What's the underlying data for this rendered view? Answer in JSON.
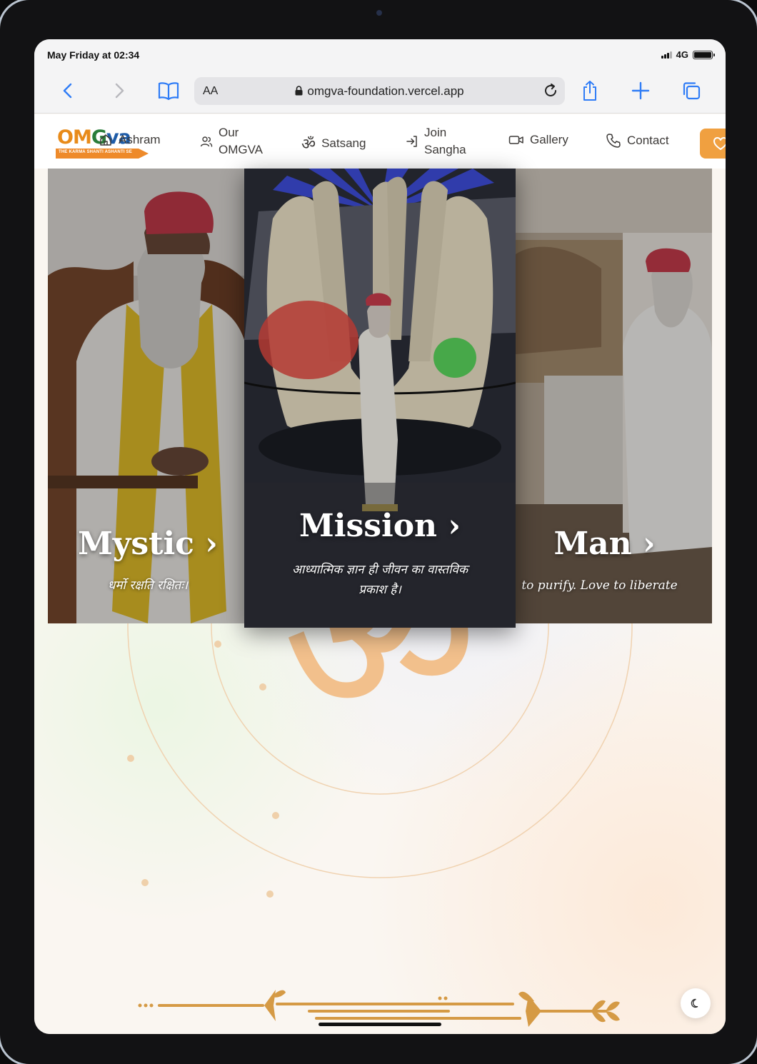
{
  "status": {
    "time": "May Friday at 02:34",
    "network": "4G"
  },
  "browser": {
    "text_size_label": "AA",
    "url": "omgva-foundation.vercel.app",
    "icons": [
      "back-icon",
      "forward-icon",
      "bookmarks-icon",
      "reload-icon",
      "share-icon",
      "new-tab-icon",
      "tabs-icon"
    ]
  },
  "site": {
    "logo": {
      "o": "OM",
      "g": "G",
      "va": "va",
      "tagline": "THE KARMA SHANTI ASHANTI SE"
    },
    "nav": [
      {
        "id": "ashram",
        "label": "Ashram",
        "icon": "home-icon"
      },
      {
        "id": "our-omgva",
        "label": "Our",
        "label2": "OMGVA",
        "icon": "users-icon"
      },
      {
        "id": "satsang",
        "label": "Satsang",
        "icon": "om-icon",
        "glyph": "ॐ"
      },
      {
        "id": "join-sangha",
        "label": "Join",
        "label2": "Sangha",
        "icon": "login-icon"
      },
      {
        "id": "gallery",
        "label": "Gallery",
        "icon": "video-icon"
      },
      {
        "id": "contact",
        "label": "Contact",
        "icon": "phone-icon"
      }
    ],
    "donate_icon": "heart-icon",
    "accent": "#f0a040"
  },
  "hero": {
    "om_glyph": "ॐ",
    "cards": [
      {
        "title": "Mystic ›",
        "subtitle": "धर्मो रक्षति रक्षितः।"
      },
      {
        "title": "Mission ›",
        "subtitle_line1": "आध्यात्मिक ज्ञान ही जीवन का वास्तविक",
        "subtitle_line2": "प्रकाश है।"
      },
      {
        "title": "Man ›",
        "subtitle": "to purify. Love to liberate"
      }
    ]
  },
  "theme_toggle_icon": "moon-icon"
}
